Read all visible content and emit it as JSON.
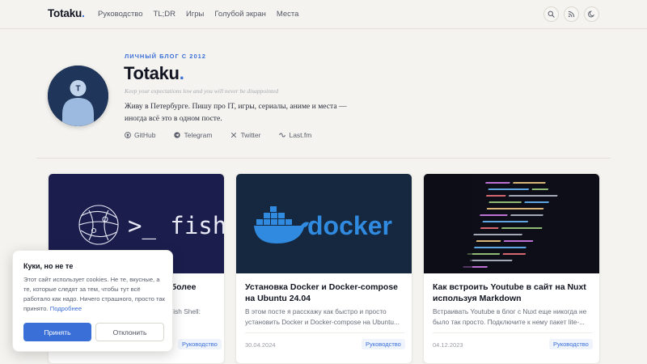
{
  "header": {
    "logo_text": "Totaku",
    "logo_dot": ".",
    "nav": [
      "Руководство",
      "TL;DR",
      "Игры",
      "Голубой экран",
      "Места"
    ],
    "icons": [
      "search-icon",
      "rss-icon",
      "moon-icon"
    ]
  },
  "profile": {
    "eyebrow": "ЛИЧНЫЙ БЛОГ С 2012",
    "title": "Totaku",
    "title_dot": ".",
    "tagline": "Keep your expectations low and you will never be disappointed",
    "bio": "Живу в Петербурге. Пишу про IT, игры, сериалы, аниме и места — иногда всё это в одном посте.",
    "socials": [
      {
        "label": "GitHub",
        "icon": "github-icon"
      },
      {
        "label": "Telegram",
        "icon": "telegram-icon"
      },
      {
        "label": "Twitter",
        "icon": "x-icon"
      },
      {
        "label": "Last.fm",
        "icon": "lastfm-icon"
      }
    ]
  },
  "cards": [
    {
      "title": "... более",
      "excerpt": "... Fish Shell:",
      "date": "",
      "tag": "Руководство",
      "image_text": ">_ fish"
    },
    {
      "title": "Установка Docker и Docker-compose на Ubuntu 24.04",
      "excerpt": "В этом посте я расскажу как быстро и просто установить Docker и Docker-compose на Ubuntu...",
      "date": "30.04.2024",
      "tag": "Руководство",
      "image_text": "docker"
    },
    {
      "title": "Как встроить Youtube в сайт на Nuxt используя Markdown",
      "excerpt": "Встраивать Youtube в блог с Nuxt еще никогда не было так просто. Подключите к нему пакет lite-...",
      "date": "04.12.2023",
      "tag": "Руководство",
      "image_text": ""
    }
  ],
  "cookie": {
    "title": "Куки, но не те",
    "text": "Этот сайт использует cookies. Не те, вкусные, а те, которые следят за тем, чтобы тут всё работало как надо. Ничего страшного, просто так принято.",
    "link": "Подробнее",
    "accept": "Принять",
    "decline": "Отклонить"
  },
  "colors": {
    "accent": "#3b6fd8",
    "background": "#f4f3ef",
    "avatar_bg": "#1f3559"
  }
}
